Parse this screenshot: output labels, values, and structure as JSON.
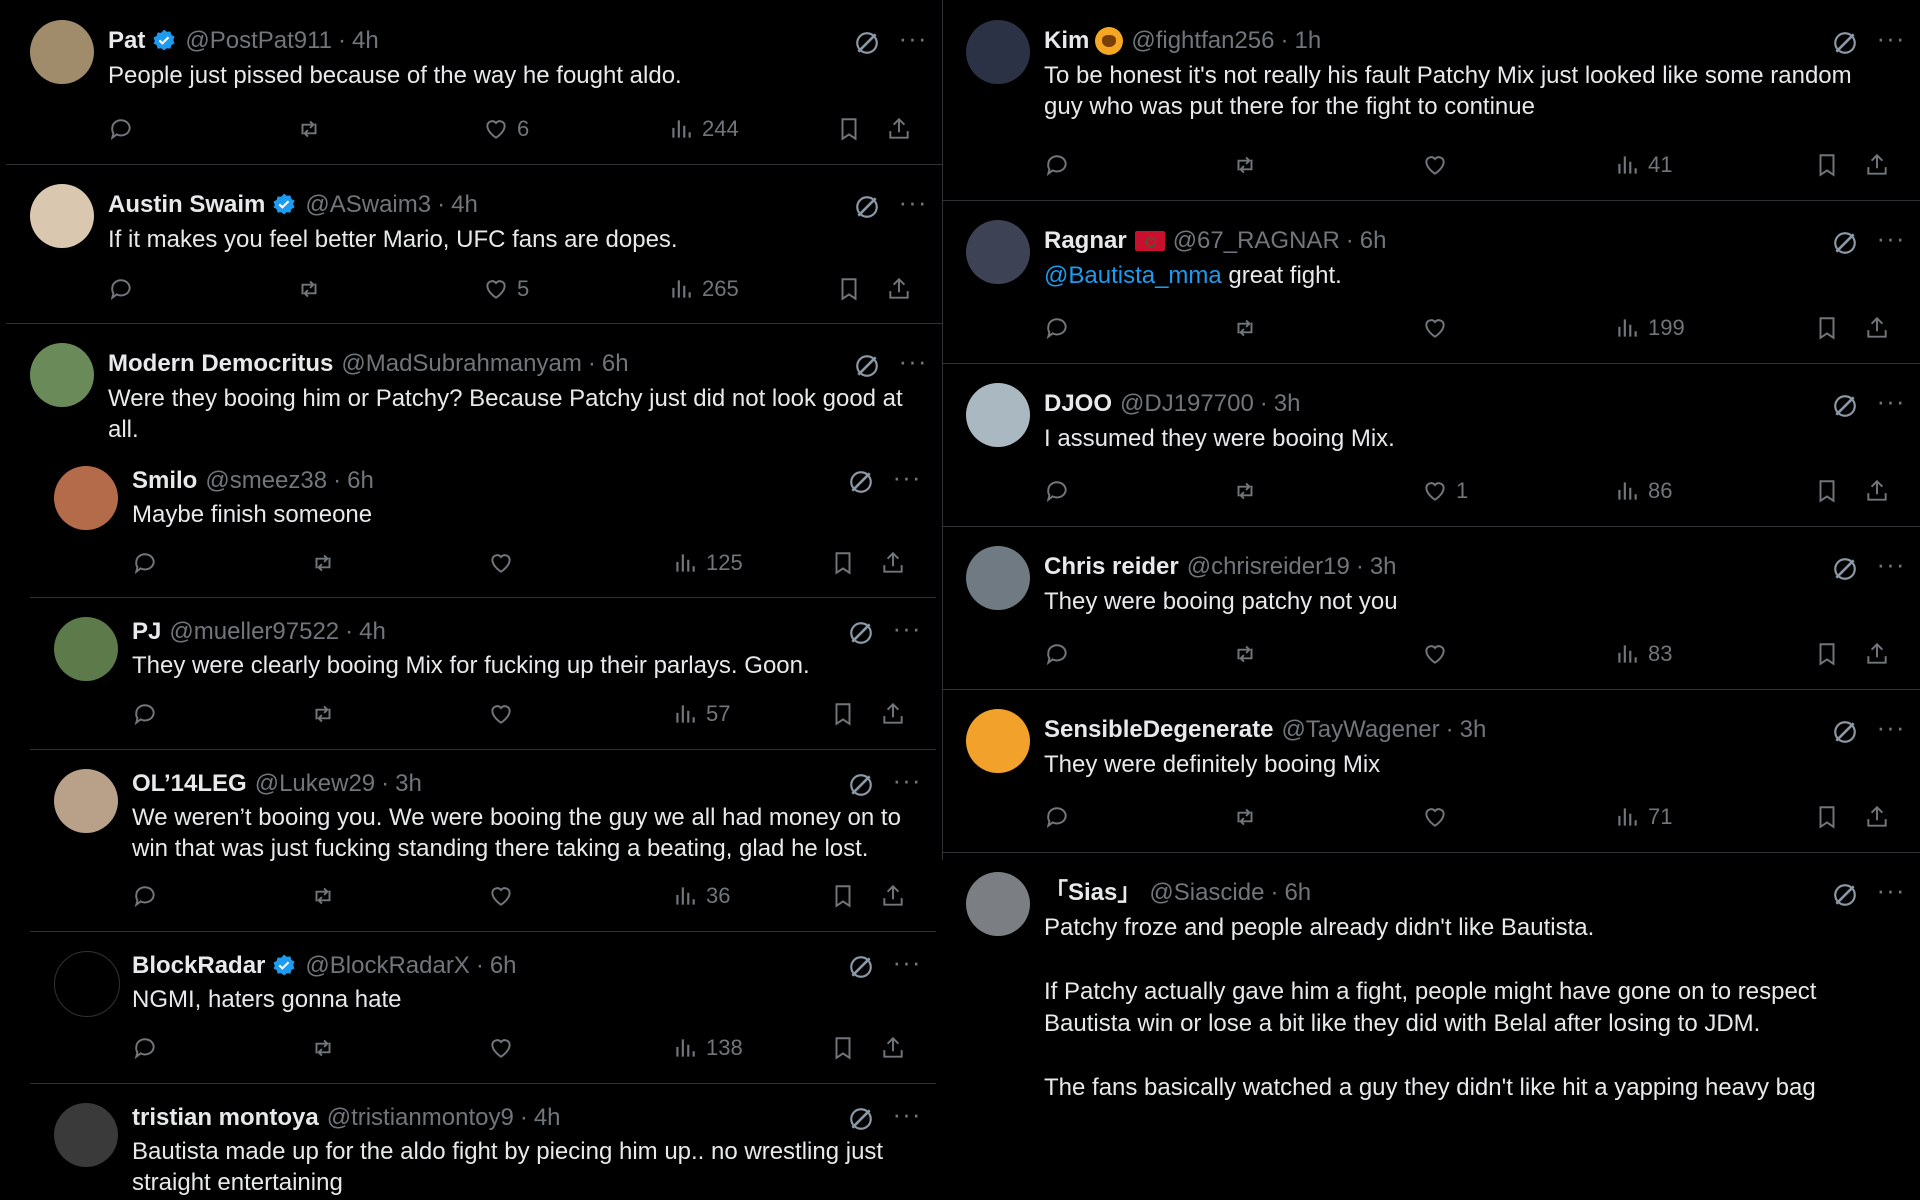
{
  "colors": {
    "background": "#000000",
    "text": "#e7e9ea",
    "muted": "#71767b",
    "link": "#1d9bf0",
    "border": "#2f3336",
    "verified": "#1d9bf0"
  },
  "icons": {
    "reply": "speech-bubble-icon",
    "retweet": "retweet-icon",
    "like": "heart-icon",
    "views": "bar-chart-icon",
    "bookmark": "bookmark-icon",
    "share": "share-icon",
    "topic": "grok-icon",
    "more": "ellipsis-icon",
    "verified": "verified-badge-icon"
  },
  "left_column": [
    {
      "name": "Pat",
      "verified": true,
      "handle": "@PostPat911",
      "sep": "·",
      "time": "4h",
      "text": "People just pissed because of the way he fought aldo.",
      "likes": "6",
      "views": "244",
      "avatar_color": "#a08c6a"
    },
    {
      "name": "Austin Swaim",
      "verified": true,
      "handle": "@ASwaim3",
      "sep": "·",
      "time": "4h",
      "text": "If it makes you feel better Mario, UFC fans are dopes.",
      "likes": "5",
      "views": "265",
      "avatar_color": "#d9c7b0"
    },
    {
      "name": "Modern Democritus",
      "verified": false,
      "handle": "@MadSubrahmanyam",
      "sep": "·",
      "time": "6h",
      "text": "Were they booing him or Patchy? Because Patchy just did not look good at all.",
      "likes": "",
      "views": "",
      "avatar_color": "#6b8a5a"
    }
  ],
  "middle_column": [
    {
      "name": "Smilo",
      "verified": false,
      "handle": "@smeez38",
      "sep": "·",
      "time": "6h",
      "text": "Maybe finish someone",
      "likes": "",
      "views": "125",
      "avatar_color": "#b36b4a"
    },
    {
      "name": "PJ",
      "verified": false,
      "handle": "@mueller97522",
      "sep": "·",
      "time": "4h",
      "text": "They were clearly booing Mix for fucking up their parlays. Goon.",
      "likes": "",
      "views": "57",
      "avatar_color": "#5d7a4a"
    },
    {
      "name": "OL’14LEG",
      "verified": false,
      "handle": "@Lukew29",
      "sep": "·",
      "time": "3h",
      "text": "We weren’t booing you. We were booing the guy we all had money on to win that was just fucking standing there taking a beating, glad he lost.",
      "likes": "",
      "views": "36",
      "avatar_color": "#b8a089"
    },
    {
      "name": "BlockRadar",
      "verified": true,
      "handle": "@BlockRadarX",
      "sep": "·",
      "time": "6h",
      "text": "NGMI, haters gonna hate",
      "likes": "",
      "views": "138",
      "avatar_color": "#000000"
    },
    {
      "name": "tristian montoya",
      "verified": false,
      "handle": "@tristianmontoy9",
      "sep": "·",
      "time": "4h",
      "text": "Bautista made up for the aldo fight by piecing him up.. no wrestling just straight entertaining",
      "likes": "",
      "views": "",
      "avatar_color": "#3a3a3a"
    }
  ],
  "right_column": [
    {
      "name": "Kim",
      "emoji": "lion-emoji",
      "verified": false,
      "handle": "@fightfan256",
      "sep": "·",
      "time": "1h",
      "text": "To be honest it's not really his fault Patchy Mix just looked like some random guy who was put there for the fight to continue",
      "likes": "",
      "views": "41",
      "avatar_color": "#2c3245"
    },
    {
      "name": "Ragnar",
      "flag": "morocco-flag",
      "verified": false,
      "handle": "@67_RAGNAR",
      "sep": "·",
      "time": "6h",
      "mention": "@Bautista_mma",
      "text": " great fight.",
      "likes": "",
      "views": "199",
      "avatar_color": "#3d4255"
    },
    {
      "name": "DJOO",
      "verified": false,
      "handle": "@DJ197700",
      "sep": "·",
      "time": "3h",
      "text": "I assumed they were booing Mix.",
      "likes": "1",
      "views": "86",
      "avatar_color": "#aab8c2"
    },
    {
      "name": "Chris reider",
      "verified": false,
      "handle": "@chrisreider19",
      "sep": "·",
      "time": "3h",
      "text": "They were booing patchy not you",
      "likes": "",
      "views": "83",
      "avatar_color": "#6f7a82"
    },
    {
      "name": "SensibleDegenerate",
      "verified": false,
      "handle": "@TayWagener",
      "sep": "·",
      "time": "3h",
      "text": "They were definitely booing Mix",
      "likes": "",
      "views": "71",
      "avatar_color": "#f2a22a"
    },
    {
      "name": "「Sias」",
      "verified": false,
      "handle": "@Siascide",
      "sep": "·",
      "time": "6h",
      "text": "Patchy froze and people already didn't like Bautista.\n\nIf Patchy actually gave him a fight, people might have gone on to respect Bautista win or lose a bit like they did with Belal after losing to JDM.\n\nThe fans basically watched a guy they didn't like hit a yapping heavy bag",
      "likes": "",
      "views": "",
      "avatar_color": "#7b7f84"
    }
  ]
}
